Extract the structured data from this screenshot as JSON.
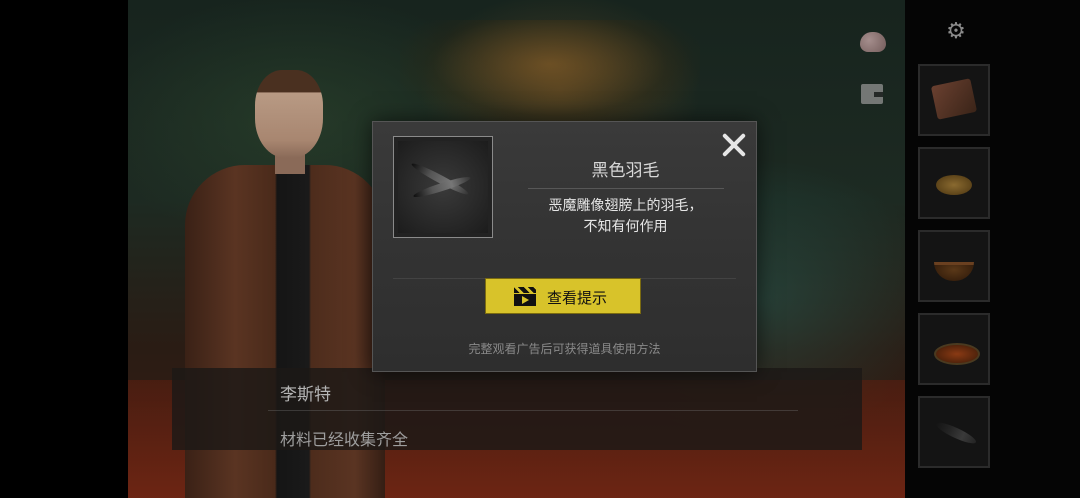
{
  "popup": {
    "item_name": "黑色羽毛",
    "item_description": "恶魔雕像翅膀上的羽毛，\n不知有何作用",
    "hint_button_label": "查看提示",
    "ad_note": "完整观看广告后可获得道具使用方法",
    "accent_color": "#d8c32a"
  },
  "dialogue": {
    "speaker": "李斯特",
    "text": "材料已经收集齐全"
  },
  "side_icons": [
    "brain-icon",
    "map-icon",
    "gear-icon"
  ],
  "inventory": {
    "slots": [
      "book-item",
      "coins-item",
      "bowl-item",
      "pot-item",
      "feather-item"
    ]
  }
}
